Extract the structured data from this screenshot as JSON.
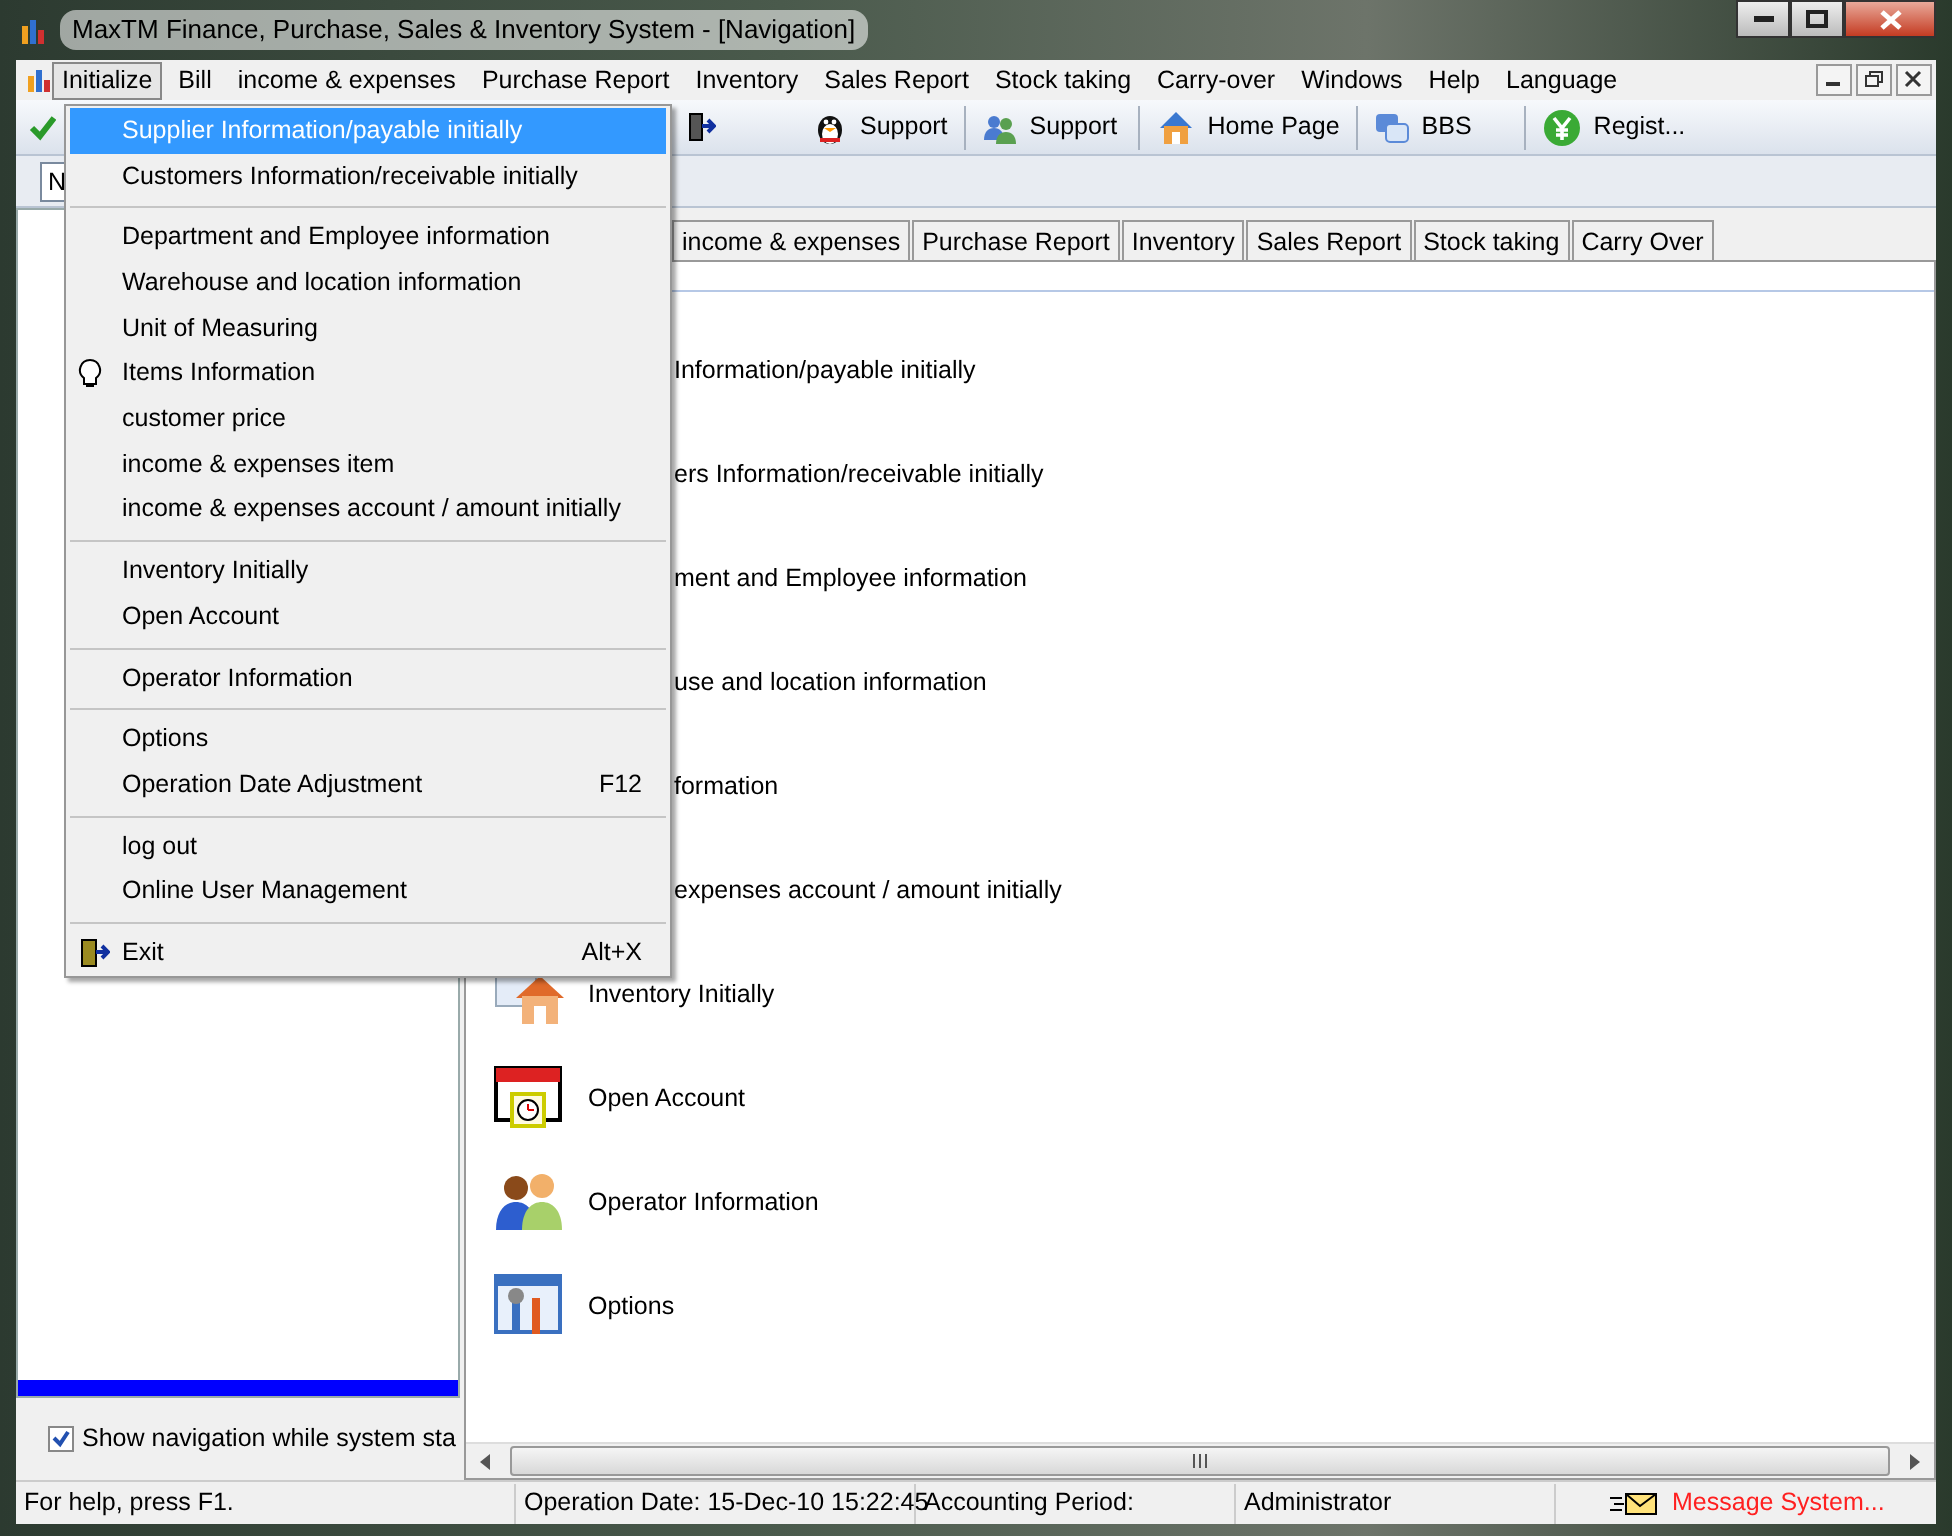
{
  "window": {
    "title": "MaxTM Finance, Purchase, Sales & Inventory System - [Navigation]"
  },
  "menubar": [
    {
      "label": "Initialize",
      "open": true
    },
    {
      "label": "Bill",
      "open": false
    },
    {
      "label": "income & expenses",
      "open": false
    },
    {
      "label": "Purchase Report",
      "open": false
    },
    {
      "label": "Inventory",
      "open": false
    },
    {
      "label": "Sales Report",
      "open": false
    },
    {
      "label": "Stock taking",
      "open": false
    },
    {
      "label": "Carry-over",
      "open": false
    },
    {
      "label": "Windows",
      "open": false
    },
    {
      "label": "Help",
      "open": false
    },
    {
      "label": "Language",
      "open": false
    }
  ],
  "menu": {
    "groups": [
      [
        {
          "label": "Supplier Information/payable initially",
          "selected": true
        },
        {
          "label": "Customers Information/receivable initially",
          "selected": false
        }
      ],
      [
        {
          "label": "Department and Employee information",
          "selected": false
        },
        {
          "label": "Warehouse and location information",
          "selected": false
        },
        {
          "label": "Unit of Measuring",
          "selected": false
        },
        {
          "label": "Items Information",
          "selected": false,
          "kind": "bulb"
        },
        {
          "label": "customer price",
          "selected": false
        },
        {
          "label": "income & expenses item",
          "selected": false
        },
        {
          "label": "income & expenses account / amount initially",
          "selected": false
        }
      ],
      [
        {
          "label": "Inventory Initially",
          "selected": false
        },
        {
          "label": "Open Account",
          "selected": false
        }
      ],
      [
        {
          "label": "Operator Information",
          "selected": false
        }
      ],
      [
        {
          "label": "Options",
          "selected": false
        },
        {
          "label": "Operation Date Adjustment",
          "selected": false,
          "shortcut": "F12"
        }
      ],
      [
        {
          "label": "log out",
          "selected": false
        },
        {
          "label": "Online User Management",
          "selected": false
        }
      ],
      [
        {
          "label": "Exit",
          "selected": false,
          "kind": "exit",
          "shortcut": "Alt+X"
        }
      ]
    ]
  },
  "toolbar": [
    {
      "label": "Support",
      "kind": "penguin"
    },
    {
      "label": "Support",
      "kind": "people"
    },
    {
      "label": "Home Page",
      "kind": "home"
    },
    {
      "label": "BBS",
      "kind": "bbs"
    },
    {
      "label": "Regist...",
      "kind": "register"
    }
  ],
  "toolbar2": {
    "field_value": "N"
  },
  "tabs": [
    "income & expenses",
    "Purchase Report",
    "Inventory",
    "Sales Report",
    "Stock taking",
    "Carry Over"
  ],
  "nav_items": [
    {
      "label": "Information/payable initially",
      "kind": "covered"
    },
    {
      "label": "ers Information/receivable initially",
      "kind": "covered"
    },
    {
      "label": "ment and Employee information",
      "kind": "covered"
    },
    {
      "label": "use and location information",
      "kind": "covered"
    },
    {
      "label": "formation",
      "kind": "covered"
    },
    {
      "label": "expenses account / amount initially",
      "kind": "covered"
    },
    {
      "label": "Inventory Initially",
      "kind": "house"
    },
    {
      "label": "Open Account",
      "kind": "calendar"
    },
    {
      "label": "Operator Information",
      "kind": "people"
    },
    {
      "label": "Options",
      "kind": "tools"
    }
  ],
  "left_panel": {
    "show_navigation": {
      "label": "Show navigation while system sta",
      "checked": true
    }
  },
  "status_bar": [
    {
      "text": "For help, press F1.",
      "kind": "plain"
    },
    {
      "text": "Operation Date: 15-Dec-10 15:22:45",
      "kind": "plain"
    },
    {
      "text": "Accounting Period:",
      "kind": "plain"
    },
    {
      "text": "Administrator",
      "kind": "plain"
    },
    {
      "text": "Message System...",
      "kind": "message"
    }
  ]
}
